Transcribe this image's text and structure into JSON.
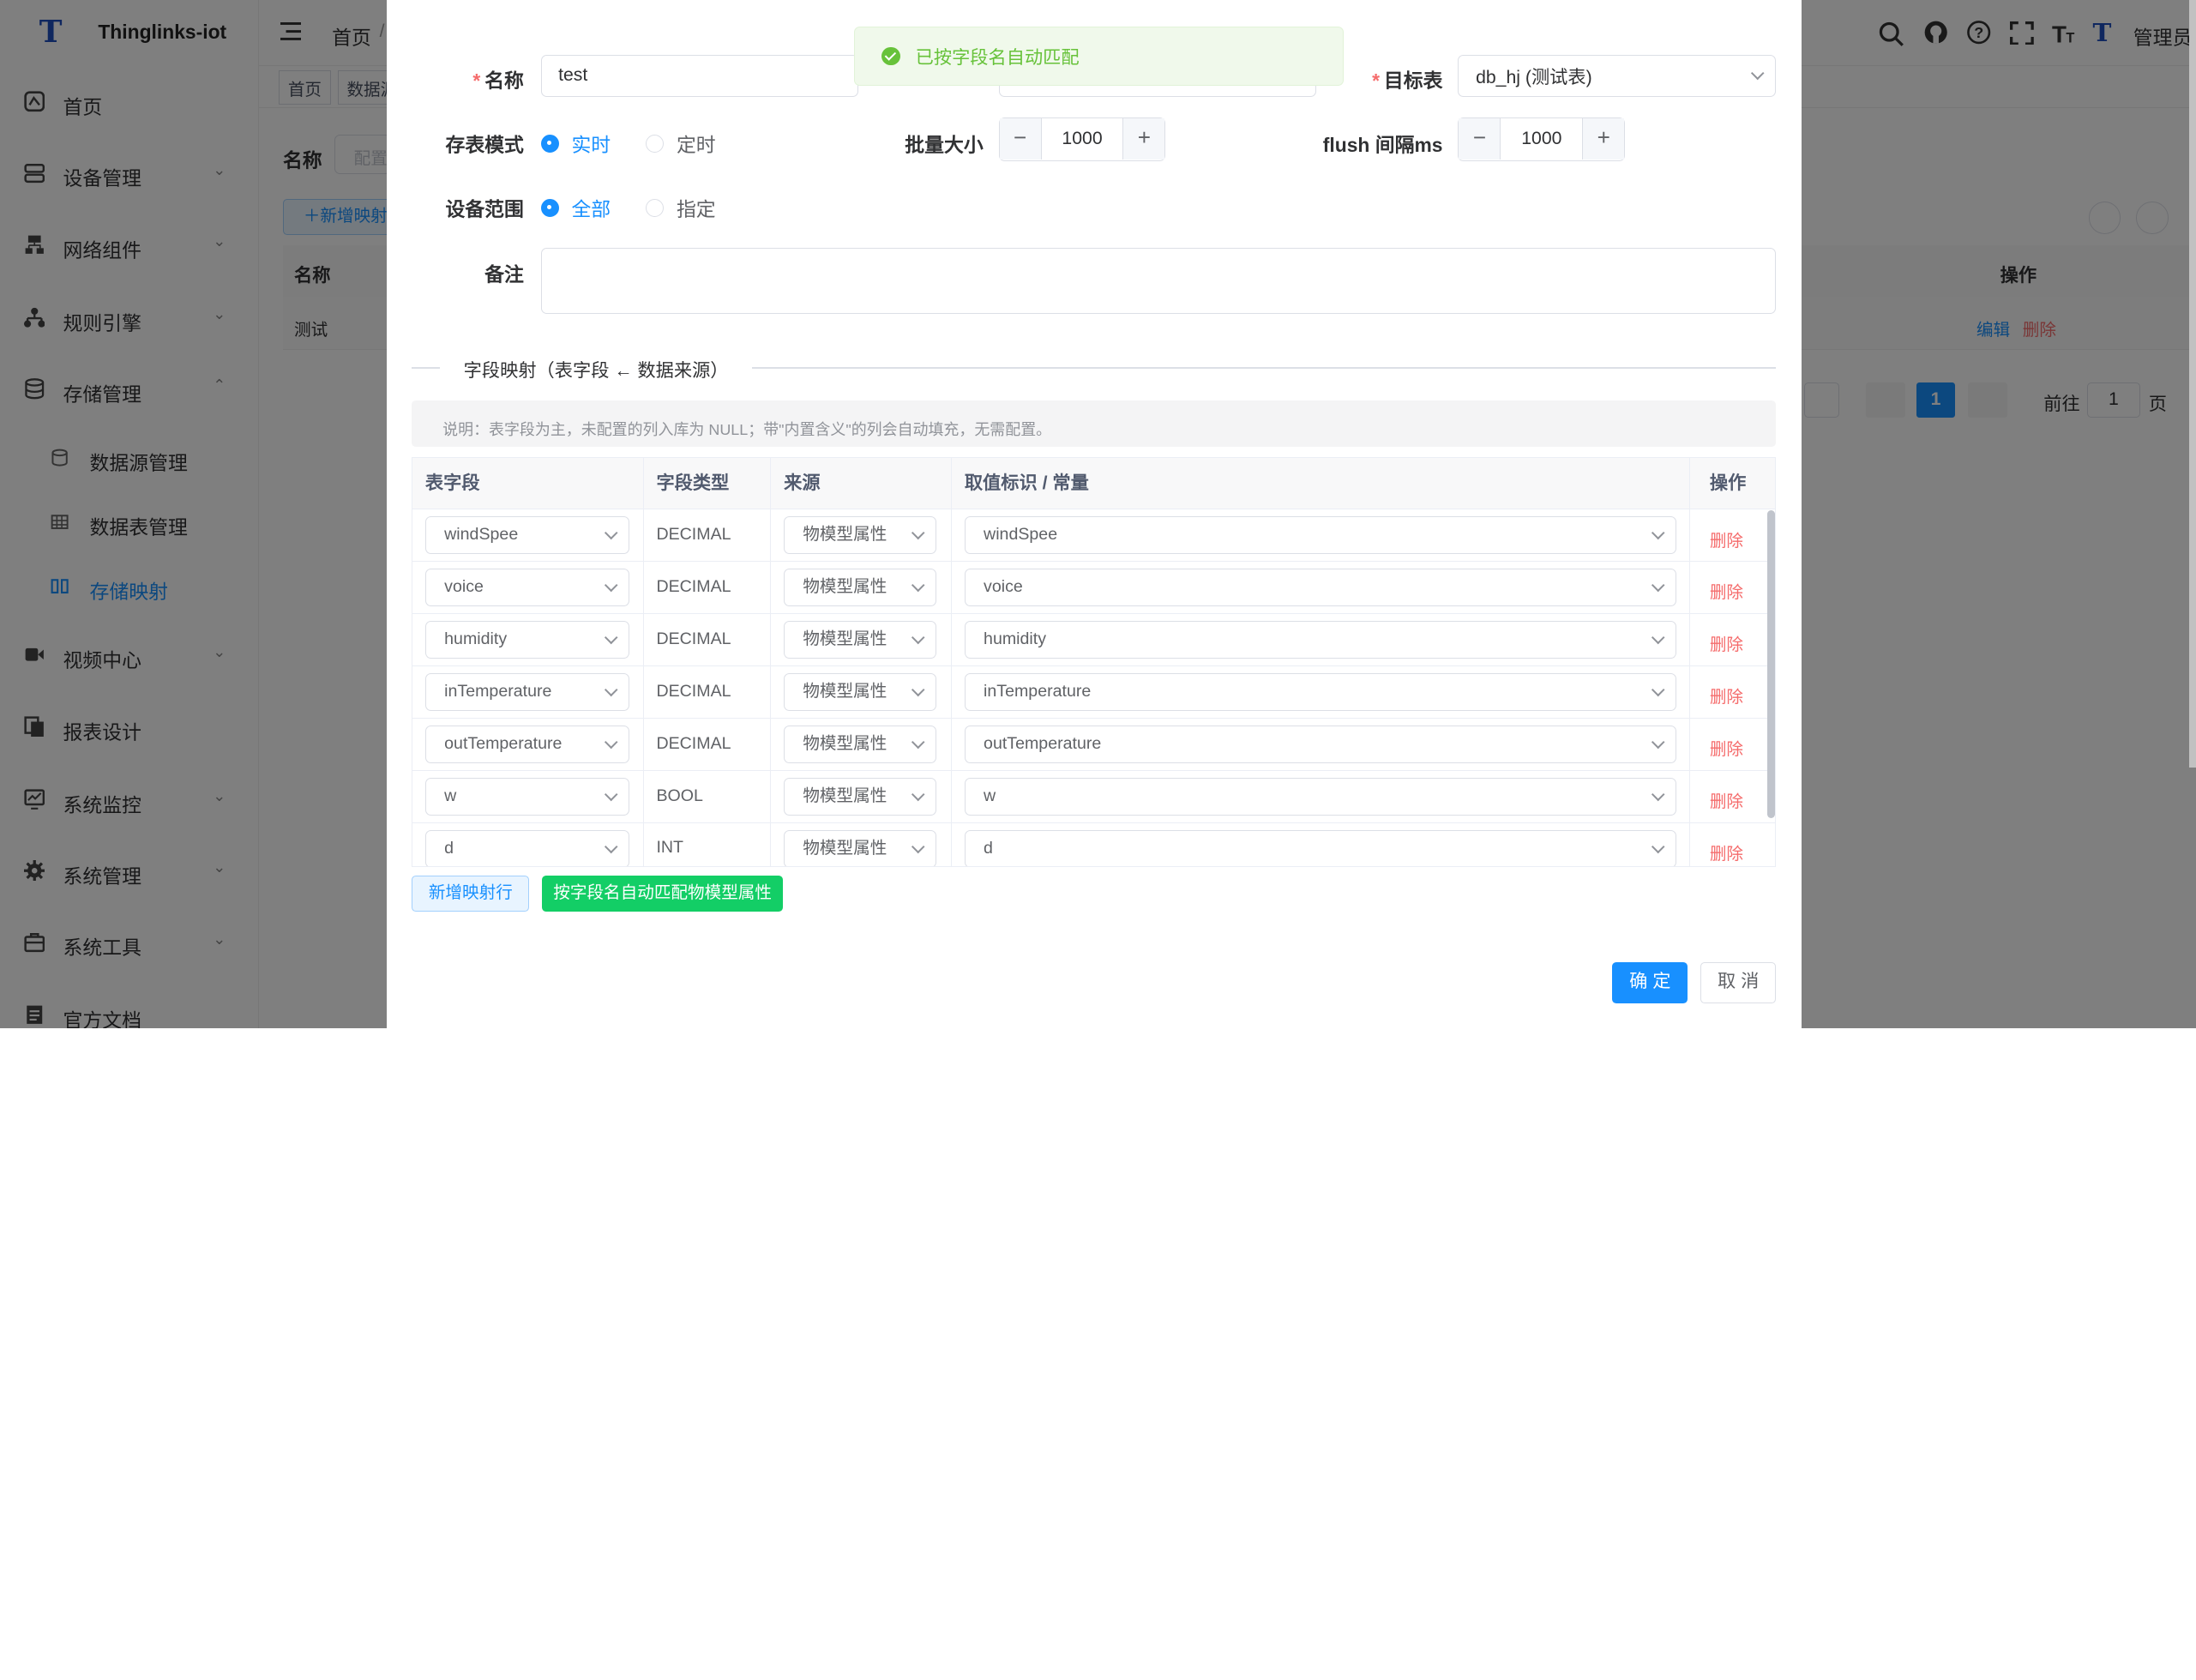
{
  "app": {
    "name": "Thinglinks-iot",
    "user": "管理员"
  },
  "sidebar": {
    "items": [
      {
        "label": "首页",
        "icon": "dashboard-icon"
      },
      {
        "label": "设备管理",
        "icon": "device-icon"
      },
      {
        "label": "网络组件",
        "icon": "network-icon"
      },
      {
        "label": "规则引擎",
        "icon": "rule-icon"
      },
      {
        "label": "存储管理",
        "icon": "storage-icon"
      },
      {
        "label": "视频中心",
        "icon": "video-icon"
      },
      {
        "label": "报表设计",
        "icon": "report-icon"
      },
      {
        "label": "系统监控",
        "icon": "monitor-icon"
      },
      {
        "label": "系统管理",
        "icon": "gear-icon"
      },
      {
        "label": "系统工具",
        "icon": "toolbox-icon"
      },
      {
        "label": "官方文档",
        "icon": "document-icon"
      }
    ],
    "storage_sub": [
      {
        "label": "数据源管理",
        "icon": "database-icon"
      },
      {
        "label": "数据表管理",
        "icon": "table-icon"
      },
      {
        "label": "存储映射",
        "icon": "mapping-icon",
        "active": true
      }
    ]
  },
  "header": {
    "breadcrumb_home": "首页",
    "breadcrumb_sep": "/"
  },
  "background_page": {
    "tags": [
      "首页",
      "数据源"
    ],
    "search_label": "名称",
    "search_placeholder": "配置",
    "add_button": "新增映射",
    "col_name": "名称",
    "col_op": "操作",
    "row_name": "测试",
    "edit": "编辑",
    "delete": "删除",
    "page_current": "1",
    "goto_label": "前往",
    "goto_value": "1",
    "page_unit": "页"
  },
  "toast": {
    "message": "已按字段名自动匹配",
    "color": "#67c23a"
  },
  "form": {
    "name_label": "名称",
    "name_value": "test",
    "target_label": "目标表",
    "target_value": "db_hj (测试表)",
    "mode_label": "存表模式",
    "mode_options": [
      "实时",
      "定时"
    ],
    "mode_selected": "实时",
    "batch_label": "批量大小",
    "batch_value": "1000",
    "flush_label": "flush 间隔ms",
    "flush_value": "1000",
    "scope_label": "设备范围",
    "scope_options": [
      "全部",
      "指定"
    ],
    "scope_selected": "全部",
    "remark_label": "备注",
    "remark_value": ""
  },
  "mapping": {
    "section_title": "字段映射（表字段 ← 数据来源）",
    "note": "说明：表字段为主，未配置的列入库为 NULL；带\"内置含义\"的列会自动填充，无需配置。",
    "columns": [
      "表字段",
      "字段类型",
      "来源",
      "取值标识 / 常量",
      "操作"
    ],
    "rows": [
      {
        "field": "windSpee",
        "type": "DECIMAL",
        "source": "物模型属性",
        "key": "windSpee",
        "action": "删除"
      },
      {
        "field": "voice",
        "type": "DECIMAL",
        "source": "物模型属性",
        "key": "voice",
        "action": "删除"
      },
      {
        "field": "humidity",
        "type": "DECIMAL",
        "source": "物模型属性",
        "key": "humidity",
        "action": "删除"
      },
      {
        "field": "inTemperature",
        "type": "DECIMAL",
        "source": "物模型属性",
        "key": "inTemperature",
        "action": "删除"
      },
      {
        "field": "outTemperature",
        "type": "DECIMAL",
        "source": "物模型属性",
        "key": "outTemperature",
        "action": "删除"
      },
      {
        "field": "w",
        "type": "BOOL",
        "source": "物模型属性",
        "key": "w",
        "action": "删除"
      },
      {
        "field": "d",
        "type": "INT",
        "source": "物模型属性",
        "key": "d",
        "action": "删除"
      }
    ],
    "add_row_button": "新增映射行",
    "auto_match_button": "按字段名自动匹配物模型属性"
  },
  "footer": {
    "confirm": "确 定",
    "cancel": "取 消"
  },
  "colors": {
    "primary": "#1890ff",
    "success": "#13ce66",
    "danger": "#f56c6c"
  }
}
